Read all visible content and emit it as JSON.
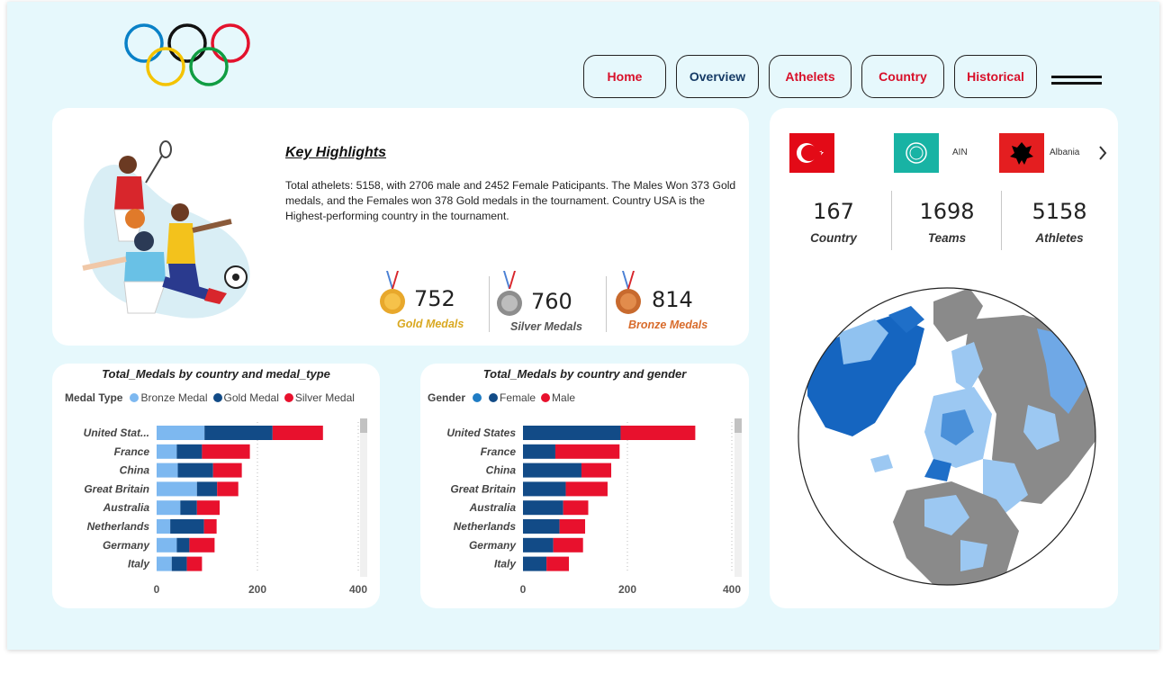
{
  "nav": [
    {
      "label": "Home",
      "color": "red"
    },
    {
      "label": "Overview",
      "color": "blue"
    },
    {
      "label": "Athelets",
      "color": "red"
    },
    {
      "label": "Country",
      "color": "red"
    },
    {
      "label": "Historical",
      "color": "red"
    }
  ],
  "highlights": {
    "title": "Key Highlights",
    "text": "Total athelets: 5158, with 2706 male and 2452 Female Paticipants. The Males Won 373 Gold medals, and the Females won 378 Gold medals in the tournament. Country USA is the Highest-performing country in the tournament.",
    "gold": {
      "value": "752",
      "label": "Gold Medals",
      "color": "#d9a820"
    },
    "silver": {
      "value": "760",
      "label": "Silver Medals",
      "color": "#555555"
    },
    "bronze": {
      "value": "814",
      "label": "Bronze Medals",
      "color": "#d86b2b"
    }
  },
  "countries_strip": {
    "items": [
      {
        "name": "",
        "flag": "turkey"
      },
      {
        "name": "AIN",
        "flag": "ain"
      },
      {
        "name": "Albania",
        "flag": "albania"
      }
    ]
  },
  "stats": [
    {
      "value": "167",
      "label": "Country"
    },
    {
      "value": "1698",
      "label": "Teams"
    },
    {
      "value": "5158",
      "label": "Athletes"
    }
  ],
  "chart_data": [
    {
      "type": "bar",
      "orientation": "horizontal",
      "stacked": true,
      "title": "Total_Medals by country and medal_type",
      "legend_title": "Medal Type",
      "categories": [
        "United Stat...",
        "France",
        "China",
        "Great Britain",
        "Australia",
        "Netherlands",
        "Germany",
        "Italy"
      ],
      "series": [
        {
          "name": "Bronze Medal",
          "color": "#7db8f0",
          "values": [
            95,
            40,
            42,
            80,
            47,
            27,
            40,
            30
          ]
        },
        {
          "name": "Gold Medal",
          "color": "#124b87",
          "values": [
            135,
            50,
            70,
            40,
            33,
            67,
            25,
            30
          ]
        },
        {
          "name": "Silver Medal",
          "color": "#e8112d",
          "values": [
            100,
            95,
            57,
            42,
            45,
            25,
            50,
            30
          ]
        }
      ],
      "xticks": [
        0,
        200,
        400
      ],
      "xlim": [
        0,
        400
      ],
      "legend_position": "top-left"
    },
    {
      "type": "bar",
      "orientation": "horizontal",
      "stacked": true,
      "title": "Total_Medals by country and gender",
      "legend_title": "Gender",
      "categories": [
        "United States",
        "France",
        "China",
        "Great Britain",
        "Australia",
        "Netherlands",
        "Germany",
        "Italy"
      ],
      "series": [
        {
          "name": "",
          "color": "#1f7cc4",
          "values": [
            0,
            0,
            0,
            0,
            0,
            0,
            0,
            0
          ]
        },
        {
          "name": "Female",
          "color": "#124b87",
          "values": [
            187,
            62,
            112,
            82,
            77,
            70,
            58,
            45
          ]
        },
        {
          "name": "Male",
          "color": "#e8112d",
          "values": [
            143,
            123,
            57,
            80,
            48,
            49,
            57,
            43
          ]
        }
      ],
      "xticks": [
        0,
        200,
        400
      ],
      "xlim": [
        0,
        400
      ],
      "legend_position": "top-left"
    }
  ]
}
